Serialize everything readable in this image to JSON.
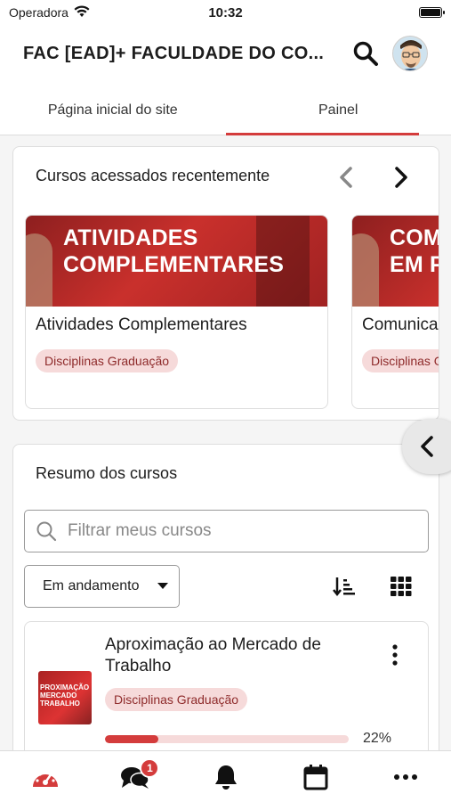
{
  "status_bar": {
    "carrier": "Operadora",
    "time": "10:32"
  },
  "header": {
    "title": "FAC [EAD]+ FACULDADE DO CO..."
  },
  "tabs": [
    {
      "label": "Página inicial do site",
      "active": false
    },
    {
      "label": "Painel",
      "active": true
    }
  ],
  "recent": {
    "title": "Cursos acessados recentemente",
    "courses": [
      {
        "image_text_line1": "ATIVIDADES",
        "image_text_line2": "COMPLEMENTARES",
        "name": "Atividades Complementares",
        "category": "Disciplinas Graduação"
      },
      {
        "image_text_line1": "COM",
        "image_text_line2": "EM P",
        "name": "Comunica",
        "category": "Disciplinas Gr"
      }
    ]
  },
  "overview": {
    "title": "Resumo dos cursos",
    "filter_placeholder": "Filtrar meus cursos",
    "status_filter": "Em andamento",
    "courses": [
      {
        "name": "Aproximação ao Mercado de Trabalho",
        "thumb_text": "PROXIMAÇÃO MERCADO TRABALHO",
        "category": "Disciplinas Graduação",
        "progress_percent": 22,
        "progress_label": "22%"
      }
    ]
  },
  "bottom_nav": {
    "items": [
      "dashboard-icon",
      "messages-icon",
      "notifications-icon",
      "calendar-icon",
      "more-icon"
    ],
    "messages_badge": "1"
  },
  "colors": {
    "accent": "#d43c3c",
    "badge_bg": "#f6dada",
    "badge_text": "#8e2a2a"
  }
}
